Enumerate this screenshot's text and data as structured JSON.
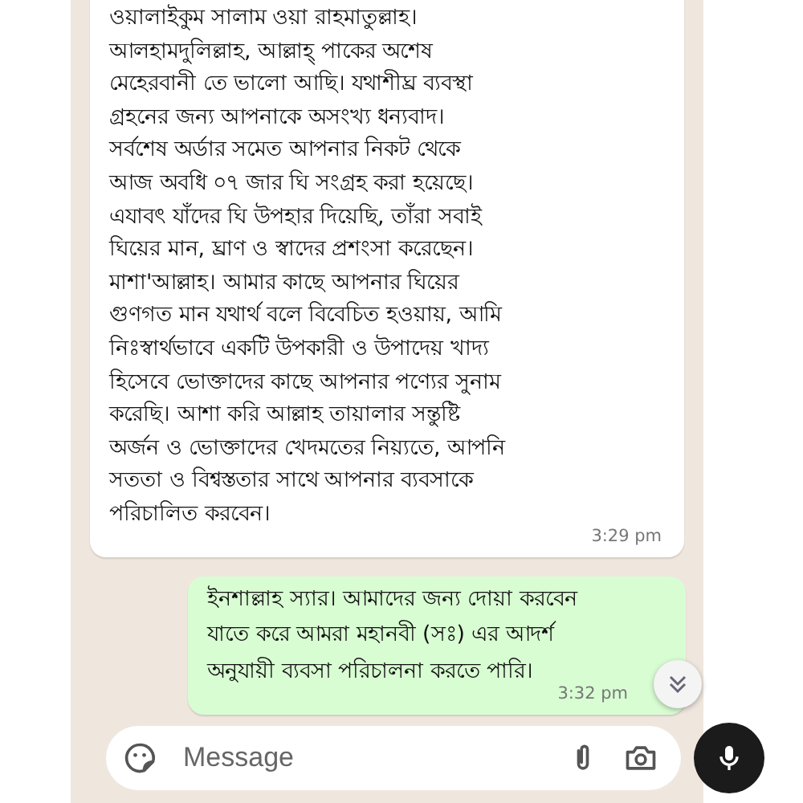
{
  "messages": [
    {
      "kind": "received",
      "text": "ওয়ালাইকুম সালাম ওয়া রাহমাতুল্লাহ।\nআলহামদুলিল্লাহ, আল্লাহ্ পাকের অশেষ\nমেহেরবানী তে ভালো আছি। যথাশীঘ্র ব্যবস্থা\nগ্রহনের জন্য আপনাকে অসংখ্য ধন্যবাদ।\nসর্বশেষ অর্ডার সমেত আপনার নিকট থেকে\nআজ অবধি ০৭ জার ঘি সংগ্রহ করা হয়েছে।\nএযাবৎ যাঁদের ঘি উপহার দিয়েছি, তাঁরা সবাই\nঘিয়ের মান, ঘ্রাণ ও স্বাদের প্রশংসা করেছেন।\nমাশা'আল্লাহ। আমার কাছে আপনার ঘিয়ের\nগুণগত মান যথার্থ বলে বিবেচিত হওয়ায়, আমি\nনিঃস্বার্থভাবে একটি উপকারী ও উপাদেয় খাদ্য\nহিসেবে ভোক্তাদের কাছে আপনার পণ্যের সুনাম\nকরেছি। আশা করি আল্লাহ তায়ালার সন্তুষ্টি\nঅর্জন ও ভোক্তাদের খেদমতের নিয়্যতে, আপনি\nসততা ও বিশ্বস্ততার সাথে আপনার ব্যবসাকে\nপরিচালিত করবেন।",
      "time": "3:29 pm"
    },
    {
      "kind": "sent",
      "text": "ইনশাল্লাহ স্যার। আমাদের জন্য দোয়া করবেন\nযাতে করে আমরা মহানবী (সঃ) এর আদর্শ\nঅনুযায়ী ব্যবসা পরিচালনা করতে পারি।",
      "time": "3:32 pm"
    }
  ],
  "composer": {
    "placeholder": "Message"
  }
}
